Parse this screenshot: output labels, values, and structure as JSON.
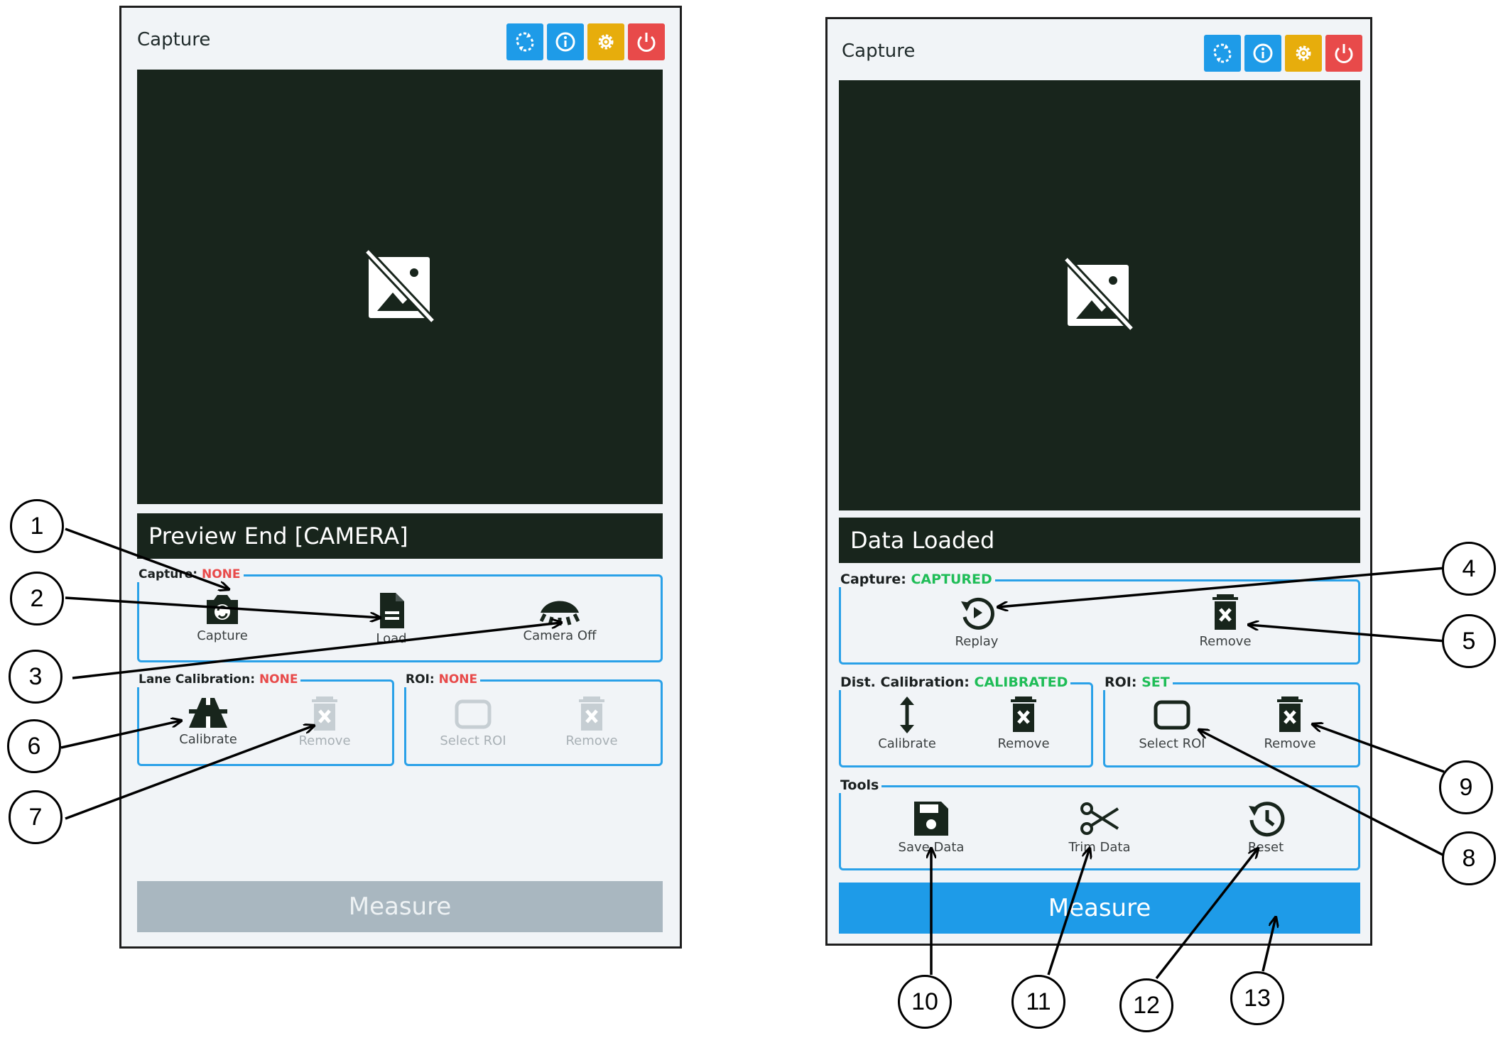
{
  "left": {
    "title": "Capture",
    "status": "Preview End [CAMERA]",
    "capture_group": {
      "label": "Capture:",
      "value": "NONE"
    },
    "capture_actions": [
      "Capture",
      "Load",
      "Camera Off"
    ],
    "lane_group": {
      "label": "Lane Calibration:",
      "value": "NONE"
    },
    "lane_actions": [
      "Calibrate",
      "Remove"
    ],
    "roi_group": {
      "label": "ROI:",
      "value": "NONE"
    },
    "roi_actions": [
      "Select ROI",
      "Remove"
    ],
    "measure": "Measure"
  },
  "right": {
    "title": "Capture",
    "status": "Data Loaded",
    "capture_group": {
      "label": "Capture:",
      "value": "CAPTURED"
    },
    "capture_actions": [
      "Replay",
      "Remove"
    ],
    "dist_group": {
      "label": "Dist. Calibration:",
      "value": "CALIBRATED"
    },
    "dist_actions": [
      "Calibrate",
      "Remove"
    ],
    "roi_group": {
      "label": "ROI:",
      "value": "SET"
    },
    "roi_actions": [
      "Select ROI",
      "Remove"
    ],
    "tools_group": {
      "label": "Tools"
    },
    "tools_actions": [
      "Save Data",
      "Trim Data",
      "Reset"
    ],
    "measure": "Measure"
  },
  "toolbar_icons": [
    "sync-icon",
    "info-icon",
    "settings-icon",
    "power-icon"
  ],
  "colors": {
    "blue": "#1e9be8",
    "yellow": "#e7ad0c",
    "red": "#e84a4a",
    "green": "#1fbd57",
    "disabled": "#a9b7c0",
    "dark": "#18251c"
  },
  "callouts": [
    "1",
    "2",
    "3",
    "4",
    "5",
    "6",
    "7",
    "8",
    "9",
    "10",
    "11",
    "12",
    "13"
  ]
}
